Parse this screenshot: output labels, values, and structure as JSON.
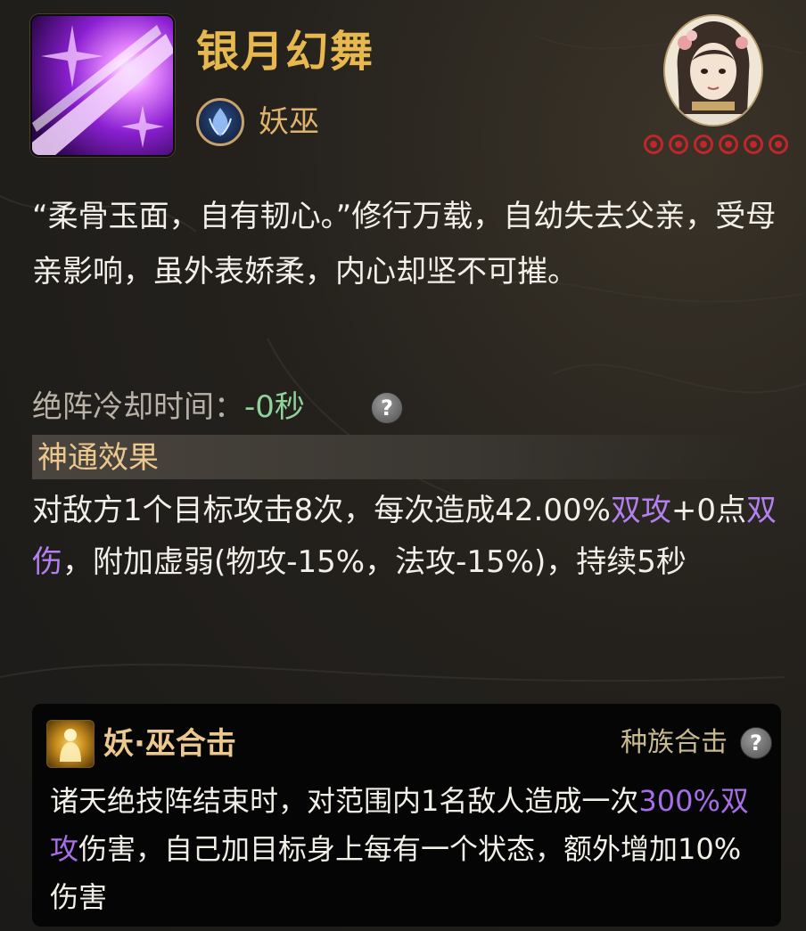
{
  "skill": {
    "name": "银月幻舞",
    "icon": "purple-star-burst-icon",
    "race_icon": "demon-shaman-race-icon",
    "race": "妖巫",
    "stars": 6
  },
  "description": "“柔骨玉面，自有韧心。”修行万载，自幼失去父亲，受母亲影响，虽外表娇柔，内心却坚不可摧。",
  "cooldown": {
    "label": "绝阵冷却时间：",
    "value": "-0秒",
    "help": "?"
  },
  "effect": {
    "header": "神通效果",
    "text_1": "对敌方1个目标攻击8次，每次造成42.00%",
    "hl_1": "双攻",
    "text_2": "+0点",
    "hl_2": "双伤",
    "text_3": "，附加虚弱(物攻-15%，法攻-15%)，持续5秒"
  },
  "combo": {
    "icon": "golden-figure-icon",
    "title": "妖·巫合击",
    "tag": "种族合击",
    "help": "?",
    "text_1": "诸天绝技阵结束时，对范围内1名敌人造成一次",
    "hl": "300%双攻",
    "text_2": "伤害，自己加目标身上每有一个状态，额外增加10%伤害"
  },
  "colors": {
    "title": "#e6b84d",
    "highlight": "#b280ef",
    "cooldown_value": "#8fd39a",
    "star": "#c1262b"
  }
}
